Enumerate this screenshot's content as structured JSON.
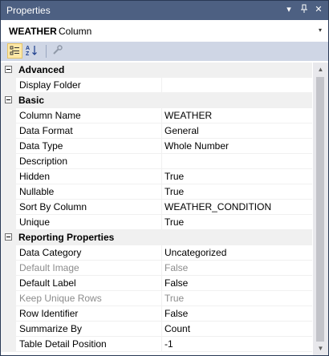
{
  "window": {
    "title": "Properties",
    "dropdown_glyph": "▾",
    "pin_glyph": "ꟷ",
    "close_glyph": "✕"
  },
  "selector": {
    "object_name": "WEATHER",
    "object_type": "Column",
    "dropdown_glyph": "▾"
  },
  "toolbar": {
    "categorized_icon": "categorized-view-icon",
    "alphabetical_icon": "alphabetical-sort-icon",
    "property_pages_icon": "wrench-icon"
  },
  "grid": {
    "advanced": {
      "title": "Advanced",
      "display_folder": {
        "name": "Display Folder",
        "value": ""
      }
    },
    "basic": {
      "title": "Basic",
      "column_name": {
        "name": "Column Name",
        "value": "WEATHER"
      },
      "data_format": {
        "name": "Data Format",
        "value": "General"
      },
      "data_type": {
        "name": "Data Type",
        "value": "Whole Number"
      },
      "description": {
        "name": "Description",
        "value": ""
      },
      "hidden": {
        "name": "Hidden",
        "value": "True"
      },
      "nullable": {
        "name": "Nullable",
        "value": "True"
      },
      "sort_by_column": {
        "name": "Sort By Column",
        "value": "WEATHER_CONDITION"
      },
      "unique": {
        "name": "Unique",
        "value": "True"
      }
    },
    "reporting": {
      "title": "Reporting Properties",
      "data_category": {
        "name": "Data Category",
        "value": "Uncategorized"
      },
      "default_image": {
        "name": "Default Image",
        "value": "False"
      },
      "default_label": {
        "name": "Default Label",
        "value": "False"
      },
      "keep_unique_rows": {
        "name": "Keep Unique Rows",
        "value": "True"
      },
      "row_identifier": {
        "name": "Row Identifier",
        "value": "False"
      },
      "summarize_by": {
        "name": "Summarize By",
        "value": "Count"
      },
      "table_detail_position": {
        "name": "Table Detail Position",
        "value": "-1"
      }
    }
  },
  "colors": {
    "title_bar": "#4d6082",
    "toolbar": "#cfd6e5",
    "disabled_text": "#8c8c8c",
    "active_button": "#fde8a7"
  }
}
